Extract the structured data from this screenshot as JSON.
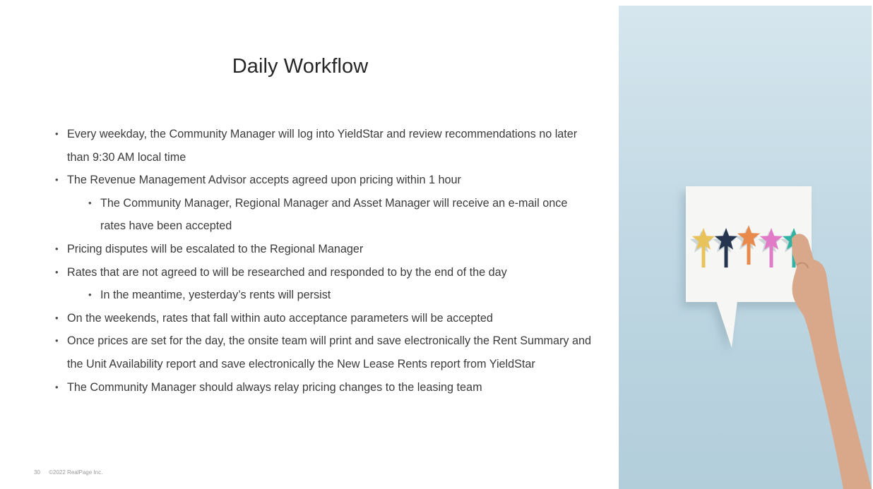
{
  "slide": {
    "title": "Daily Workflow",
    "bullets": [
      {
        "level": 1,
        "text": "Every weekday, the Community Manager will log into YieldStar and review recommendations no later than 9:30 AM local time"
      },
      {
        "level": 1,
        "text": "The Revenue Management Advisor accepts agreed upon pricing within 1 hour"
      },
      {
        "level": 2,
        "text": "The Community Manager, Regional Manager and Asset Manager will receive an e-mail once rates have been accepted"
      },
      {
        "level": 1,
        "text": "Pricing disputes will be escalated to the Regional Manager"
      },
      {
        "level": 1,
        "text": "Rates that are not agreed to will be researched and responded to by the end of the day"
      },
      {
        "level": 2,
        "text": "In the meantime, yesterday’s rents will persist"
      },
      {
        "level": 1,
        "text": "On the weekends, rates that fall within auto acceptance parameters will be accepted"
      },
      {
        "level": 1,
        "text": "Once prices are set for the day, the onsite team will print and save electronically the Rent Summary and the Unit Availability report and save electronically the New Lease Rents report from YieldStar"
      },
      {
        "level": 1,
        "text": "The Community Manager should always relay pricing changes to the leasing team"
      }
    ],
    "bullet_glyph": "•",
    "footer": {
      "page_number": "30",
      "copyright": "©2022 RealPage Inc."
    }
  },
  "image": {
    "description_icon": "speech-bubble-stars-icon",
    "star_colors": [
      "#e8c25a",
      "#27344f",
      "#e98a4d",
      "#e17bc7",
      "#2fb3a3"
    ],
    "background_color": "#c3dae4"
  }
}
